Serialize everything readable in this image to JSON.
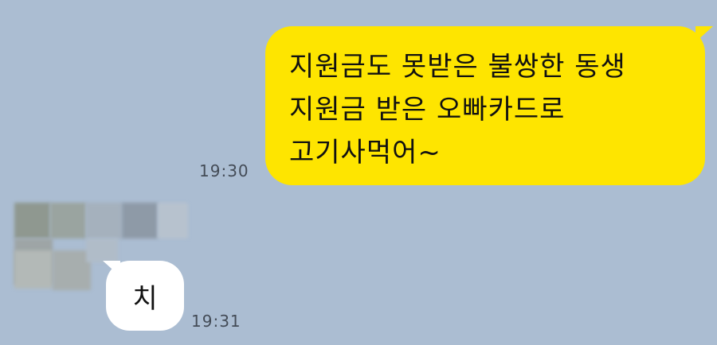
{
  "sent_message": {
    "lines": [
      "지원금도 못받은 불쌍한 동생",
      "지원금 받은 오빠카드로",
      "고기사먹어~"
    ],
    "time": "19:30"
  },
  "received_message": {
    "text": "치",
    "time": "19:31"
  },
  "colors": {
    "background": "#abbdd2",
    "sent_bubble": "#fee500",
    "received_bubble": "#ffffff"
  }
}
